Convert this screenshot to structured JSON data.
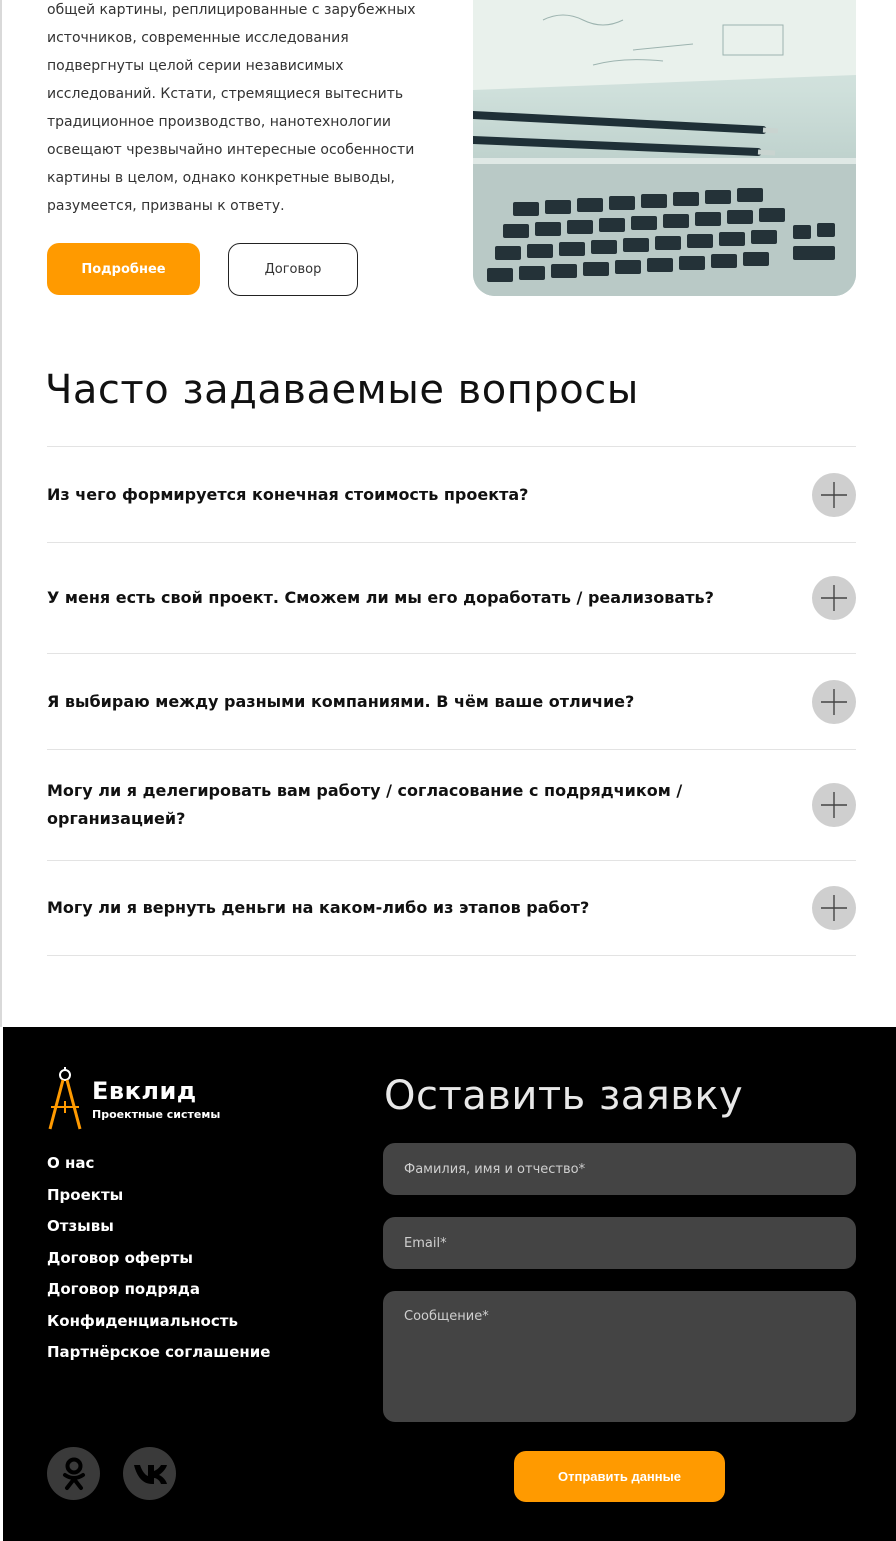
{
  "about": {
    "paragraph": "общей картины, реплицированные с зарубежных источников, современные исследования подвергнуты целой серии независимых исследований. Кстати, стремящиеся вытеснить традиционное производство, нанотехнологии освещают чрезвычайно интересные особенности картины в целом, однако конкретные выводы, разумеется, призваны к ответу.",
    "more_button": "Подробнее",
    "contract_button": "Договор"
  },
  "faq": {
    "title": "Часто задаваемые вопросы",
    "items": [
      {
        "question": "Из чего формируется конечная стоимость проекта?"
      },
      {
        "question": "У меня есть свой проект. Сможем ли мы его доработать / реализовать?"
      },
      {
        "question": "Я выбираю между разными компаниями. В чём ваше отличие?"
      },
      {
        "question": "Могу ли я делегировать вам работу / согласование с подрядчиком / организацией?"
      },
      {
        "question": "Могу ли я вернуть деньги на каком-либо из этапов работ?"
      }
    ]
  },
  "footer": {
    "logo_name": "Евклид",
    "logo_sub": "Проектные системы",
    "nav": [
      "О нас",
      "Проекты",
      "Отзывы",
      "Договор оферты",
      "Договор подряда",
      "Конфиденциальность",
      "Партнёрское соглашение"
    ],
    "form": {
      "title": "Оставить заявку",
      "name_placeholder": "Фамилия, имя и отчество*",
      "email_placeholder": "Email*",
      "message_placeholder": "Сообщение*",
      "submit": "Отправить данные"
    },
    "social": [
      "odnoklassniki-icon",
      "vk-icon"
    ]
  },
  "colors": {
    "accent": "#ff9a00",
    "footer_bg": "#000000",
    "field_bg": "#444444",
    "toggle_bg": "#cfcfcf"
  }
}
